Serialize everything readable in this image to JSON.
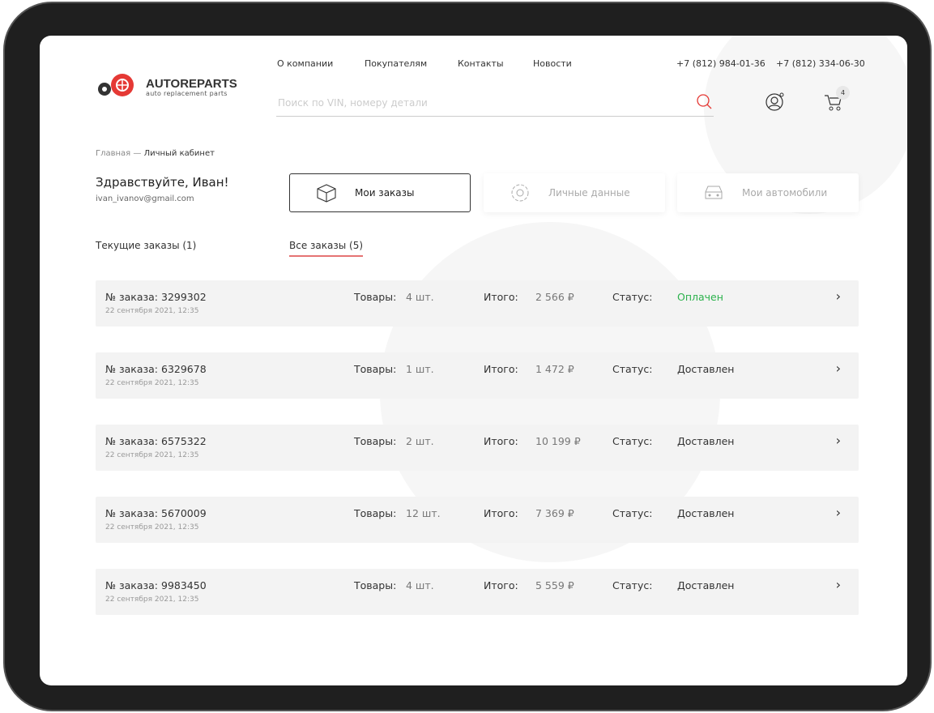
{
  "logo": {
    "title": "AUTOREPARTS",
    "subtitle": "auto replacement parts"
  },
  "nav": [
    "О компании",
    "Покупателям",
    "Контакты",
    "Новости"
  ],
  "phones": [
    "+7 (812) 984-01-36",
    "+7 (812) 334-06-30"
  ],
  "search": {
    "placeholder": "Поиск по VIN, номеру детали"
  },
  "cart": {
    "count": "4"
  },
  "breadcrumb": {
    "home": "Главная",
    "sep": " — ",
    "current": "Личный кабинет"
  },
  "user": {
    "greeting": "Здравствуйте, Иван!",
    "email": "ivan_ivanov@gmail.com"
  },
  "cards": [
    "Мои заказы",
    "Личные данные",
    "Мои автомобили"
  ],
  "tabs": [
    "Текущие заказы (1)",
    "Все заказы (5)"
  ],
  "labels": {
    "order": "№ заказа:",
    "items": "Товары:",
    "total": "Итого:",
    "status": "Статус:"
  },
  "colors": {
    "accent": "#e53935",
    "paid": "#2bb24c"
  },
  "orders": [
    {
      "number": "3299302",
      "date": "22 сентября 2021, 12:35",
      "items": "4 шт.",
      "total": "2 566 ₽",
      "status": "Оплачен"
    },
    {
      "number": "6329678",
      "date": "22 сентября 2021, 12:35",
      "items": "1 шт.",
      "total": "1 472 ₽",
      "status": "Доставлен"
    },
    {
      "number": "6575322",
      "date": "22 сентября 2021, 12:35",
      "items": "2 шт.",
      "total": "10 199 ₽",
      "status": "Доставлен"
    },
    {
      "number": "5670009",
      "date": "22 сентября 2021, 12:35",
      "items": "12 шт.",
      "total": "7 369 ₽",
      "status": "Доставлен"
    },
    {
      "number": "9983450",
      "date": "22 сентября 2021, 12:35",
      "items": "4 шт.",
      "total": "5 559 ₽",
      "status": "Доставлен"
    }
  ]
}
